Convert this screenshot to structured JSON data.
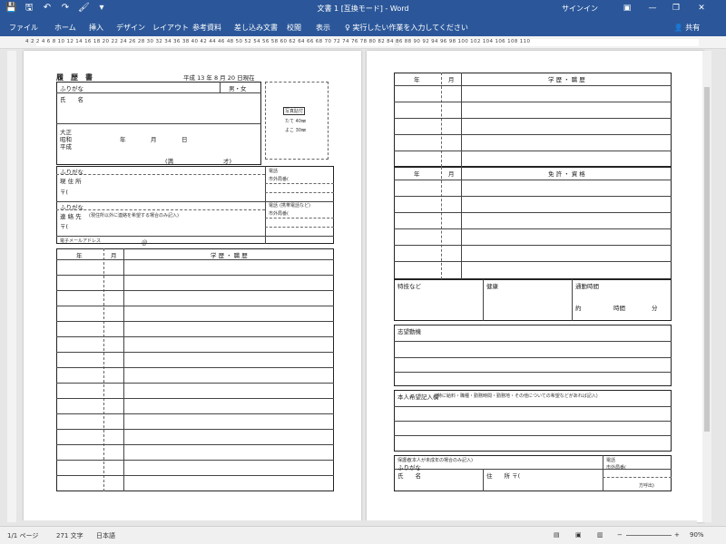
{
  "titlebar": {
    "title": "文書 1 [互換モード] - Word",
    "signin": "サインイン",
    "qat": [
      "💾",
      "🖫",
      "↶",
      "↷",
      "🖌",
      "▾"
    ],
    "icons": [
      "save-icon",
      "save-as-icon",
      "undo-icon",
      "redo-icon",
      "format-painter-icon",
      "customize-icon"
    ]
  },
  "ribbon": {
    "tabs": [
      "ファイル",
      "ホーム",
      "挿入",
      "デザイン",
      "レイアウト",
      "参考資料",
      "差し込み文書",
      "校閲",
      "表示"
    ],
    "tell_me": "実行したい作業を入力してください",
    "share": "共有"
  },
  "ruler": {
    "numbers": "4 2 2 4 6 8 10 12 14 16 18 20 22 24 26 28 30 32 34 36 38 40 42 44 46 48 50 52 54 56 58 60 62 64 66 68 70 72 74 76 78 80 82 84 86 88 90 92 94 96 98 100 102 104 106 108 110"
  },
  "page1": {
    "title": "履　歴　書",
    "date": "平成 13 年 8 月 20 日現在",
    "furigana": "ふりがな",
    "gender": "男・女",
    "name": "氏　　名",
    "photo_title": "写真貼付",
    "photo_size1": "たて 40㎜",
    "photo_size2": "よこ 30㎜",
    "era1": "大正",
    "era2": "昭和",
    "era3": "平成",
    "year": "年",
    "month": "月",
    "day": "日",
    "age": "(満",
    "age_unit": "才)",
    "furigana2": "ふりがな",
    "address": "現 住 所",
    "postal": "〒(",
    "tel": "電話",
    "area_code": "市外局番(",
    "furigana3": "ふりがな",
    "contact": "連 絡 先 ",
    "contact_note": "(現住所以外に連絡を希望する場合のみ記入)",
    "postal2": "〒(",
    "tel2": "電話",
    "tel2_note": "(携帯電話など)",
    "area_code2": "市外局番(",
    "email": "電子メールアドレス",
    "email_at": "＠",
    "history_header": {
      "year": "年",
      "month": "月",
      "content": "学 歴 ・ 職 歴"
    }
  },
  "page2": {
    "history_header": {
      "year": "年",
      "month": "月",
      "content": "学 歴 ・ 職 歴"
    },
    "license_header": {
      "year": "年",
      "month": "月",
      "content": "免 許 ・ 資 格"
    },
    "hobby": "特技など",
    "health": "健康",
    "commute": "通勤時間",
    "commute_about": "約",
    "commute_hours": "時間",
    "commute_minutes": "分",
    "motivation": "志望動機",
    "request": "本人希望記入欄",
    "request_note": "(特に給料・職種・勤務時間・勤務地・その他についての希望などがあれば記入)",
    "guardian": "保護者",
    "guardian_note": "(本人が未成年の場合のみ記入)",
    "furigana": "ふりがな",
    "name": "氏　　名",
    "address": "住　　所 〒(",
    "tel": "電話",
    "area_code": "市外局番(",
    "guardian_right_note": "方呼出)"
  },
  "status": {
    "page": "1/1 ページ",
    "words": "271 文字",
    "lang": "日本語",
    "zoom": "90%"
  }
}
